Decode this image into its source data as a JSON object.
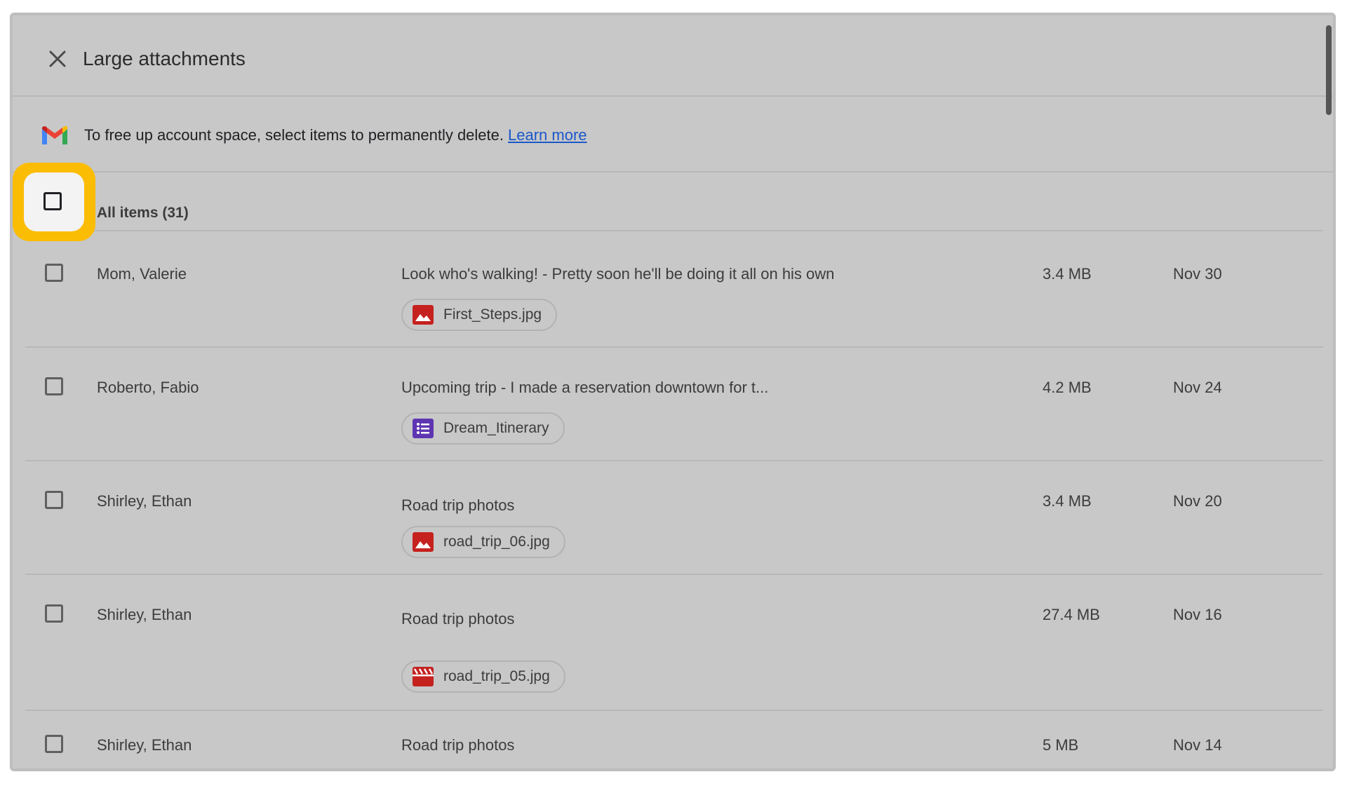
{
  "dialog": {
    "title": "Large attachments",
    "info_text": "To free up account space, select items to permanently delete.",
    "learn_more": "Learn more",
    "all_items_label": "All items (31)"
  },
  "rows": [
    {
      "sender": "Mom, Valerie",
      "subject": "Look who's walking! - Pretty soon he'll be doing it all on his own",
      "size": "3.4 MB",
      "date": "Nov 30",
      "attachment": "First_Steps.jpg",
      "attachment_type": "image-icon"
    },
    {
      "sender": "Roberto, Fabio",
      "subject": "Upcoming trip - I made a reservation downtown for t...",
      "size": "4.2 MB",
      "date": "Nov 24",
      "attachment": "Dream_Itinerary",
      "attachment_type": "forms-icon"
    },
    {
      "sender": "Shirley, Ethan",
      "subject": "Road trip photos",
      "size": "3.4 MB",
      "date": "Nov 20",
      "attachment": "road_trip_06.jpg",
      "attachment_type": "image-icon"
    },
    {
      "sender": "Shirley, Ethan",
      "subject": "Road trip photos",
      "size": "27.4 MB",
      "date": "Nov 16",
      "attachment": "road_trip_05.jpg",
      "attachment_type": "video-icon"
    },
    {
      "sender": "Shirley, Ethan",
      "subject": "Road trip photos",
      "size": "5 MB",
      "date": "Nov 14"
    }
  ],
  "colors": {
    "highlight": "#fbbc04",
    "link": "#1a57c9",
    "image_icon": "#c5221f",
    "forms_icon": "#5e35b1"
  }
}
